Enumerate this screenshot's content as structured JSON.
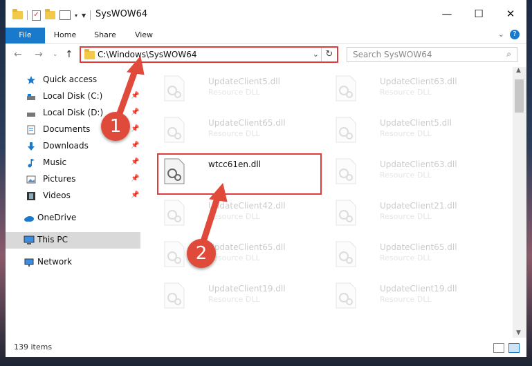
{
  "window": {
    "title": "SysWOW64",
    "controls": {
      "minimize": "—",
      "maximize": "☐",
      "close": "✕"
    }
  },
  "ribbon": {
    "tabs": [
      "File",
      "Home",
      "Share",
      "View"
    ],
    "help": "?"
  },
  "address": {
    "path": "C:\\Windows\\SysWOW64",
    "search_placeholder": "Search SysWOW64"
  },
  "navpane": {
    "items": [
      {
        "label": "Quick access",
        "icon": "star-icon",
        "pinned": false
      },
      {
        "label": "Local Disk (C:)",
        "icon": "drive-icon",
        "pinned": true
      },
      {
        "label": "Local Disk (D:)",
        "icon": "drive-icon",
        "pinned": true
      },
      {
        "label": "Documents",
        "icon": "documents-icon",
        "pinned": true
      },
      {
        "label": "Downloads",
        "icon": "download-icon",
        "pinned": true
      },
      {
        "label": "Music",
        "icon": "music-icon",
        "pinned": true
      },
      {
        "label": "Pictures",
        "icon": "pictures-icon",
        "pinned": true
      },
      {
        "label": "Videos",
        "icon": "videos-icon",
        "pinned": true
      },
      {
        "label": "OneDrive",
        "icon": "cloud-icon",
        "pinned": false
      },
      {
        "label": "This PC",
        "icon": "computer-icon",
        "pinned": false,
        "selected": true
      },
      {
        "label": "Network",
        "icon": "network-icon",
        "pinned": false
      }
    ]
  },
  "files": [
    {
      "name": "UpdateClient5.dll",
      "type": "Resource DLL"
    },
    {
      "name": "UpdateClient63.dll",
      "type": "Resource DLL"
    },
    {
      "name": "UpdateClient65.dll",
      "type": "Resource DLL"
    },
    {
      "name": "UpdateClient5.dll",
      "type": "Resource DLL"
    },
    {
      "name": "wtcc61en.dll",
      "type": ""
    },
    {
      "name": "UpdateClient63.dll",
      "type": "Resource DLL"
    },
    {
      "name": "UpdateClient42.dll",
      "type": "Resource DLL"
    },
    {
      "name": "UpdateClient21.dll",
      "type": "Resource DLL"
    },
    {
      "name": "UpdateClient65.dll",
      "type": "Resource DLL"
    },
    {
      "name": "UpdateClient65.dll",
      "type": "Resource DLL"
    },
    {
      "name": "UpdateClient19.dll",
      "type": "Resource DLL"
    },
    {
      "name": "UpdateClient19.dll",
      "type": "Resource DLL"
    }
  ],
  "status": {
    "count": "139 items"
  },
  "annotations": {
    "step1": "1",
    "step2": "2",
    "color": "#e04a3a"
  }
}
